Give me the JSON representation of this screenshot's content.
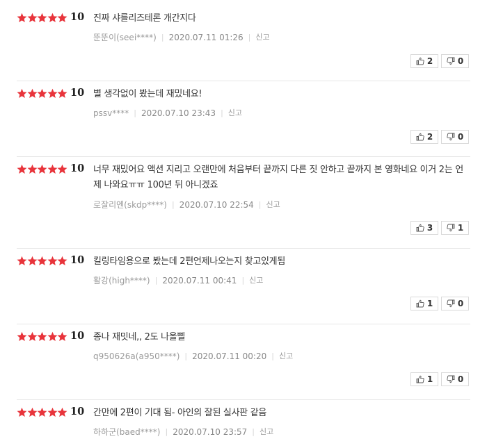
{
  "reviews": [
    {
      "score": "10",
      "text": "진짜 샤를리즈테론 개간지다",
      "user": "뚠뚠이(seei****)",
      "date": "2020.07.11 01:26",
      "report": "신고",
      "likes": "2",
      "dislikes": "0"
    },
    {
      "score": "10",
      "text": "별 생각없이 봤는데 재밌네요!",
      "user": "pssv****",
      "date": "2020.07.10 23:43",
      "report": "신고",
      "likes": "2",
      "dislikes": "0"
    },
    {
      "score": "10",
      "text": "너무 재밌어요 액션 지리고 오랜만에 처음부터 끝까지 다른 짓 안하고 끝까지 본 영화네요 이거 2는 언제 나와요ㅠㅠ 100년 뒤 아니겠죠",
      "user": "로잘리엔(skdp****)",
      "date": "2020.07.10 22:54",
      "report": "신고",
      "likes": "3",
      "dislikes": "1"
    },
    {
      "score": "10",
      "text": "킬링타임용으로 봤는데 2편언제나오는지 찾고있게됨",
      "user": "활강(high****)",
      "date": "2020.07.11 00:41",
      "report": "신고",
      "likes": "1",
      "dislikes": "0"
    },
    {
      "score": "10",
      "text": "종나 재밋네,, 2도 나올삘",
      "user": "q950626a(a950****)",
      "date": "2020.07.11 00:20",
      "report": "신고",
      "likes": "1",
      "dislikes": "0"
    },
    {
      "score": "10",
      "text": "간만에 2편이 기대 됨- 아인의 잘된 실사판 같음",
      "user": "하하군(baed****)",
      "date": "2020.07.10 23:57",
      "report": "신고",
      "likes": "",
      "dislikes": ""
    }
  ],
  "colors": {
    "star": "#e8343b",
    "score": "#222222",
    "meta": "#999999",
    "button_border": "#d9d9d9"
  },
  "icons": {
    "like": "thumbs-up-icon",
    "dislike": "thumbs-down-icon",
    "rating": "star-icon"
  }
}
